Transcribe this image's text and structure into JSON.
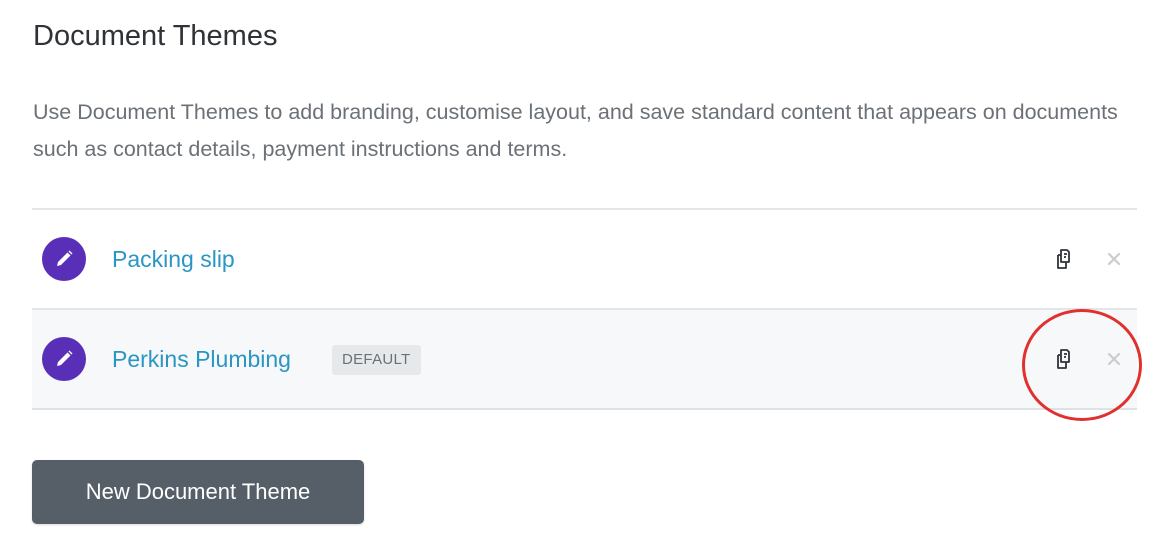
{
  "page": {
    "title": "Document Themes",
    "description": "Use Document Themes to add branding, customise layout, and save standard content that appears on documents such as contact details, payment instructions and terms."
  },
  "themes": [
    {
      "name": "Packing slip",
      "badge": ""
    },
    {
      "name": "Perkins Plumbing",
      "badge": "DEFAULT"
    }
  ],
  "actions": {
    "new_theme_label": "New Document Theme"
  },
  "icons": {
    "edit": "pencil-icon",
    "copy": "copy-icon",
    "delete": "close-icon"
  },
  "colors": {
    "edit_button_bg": "#5a2fb8",
    "link": "#2b95c4",
    "primary_button_bg": "#565f67",
    "annotation": "#e0312e"
  }
}
